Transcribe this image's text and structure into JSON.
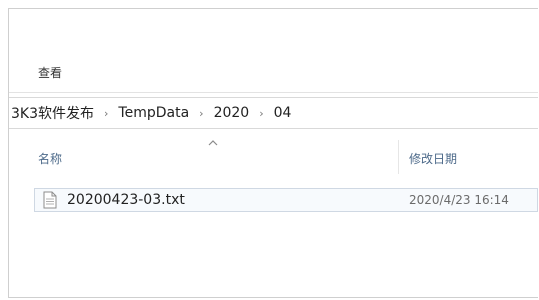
{
  "ribbon": {
    "tab_label": "查看"
  },
  "breadcrumb": {
    "items": [
      "3K3软件发布",
      "TempData",
      "2020",
      "04"
    ],
    "separator": "›"
  },
  "columns": {
    "name": "名称",
    "date_modified": "修改日期"
  },
  "files": [
    {
      "name": "20200423-03.txt",
      "date_modified": "2020/4/23 16:14",
      "icon": "text-file-icon"
    }
  ]
}
